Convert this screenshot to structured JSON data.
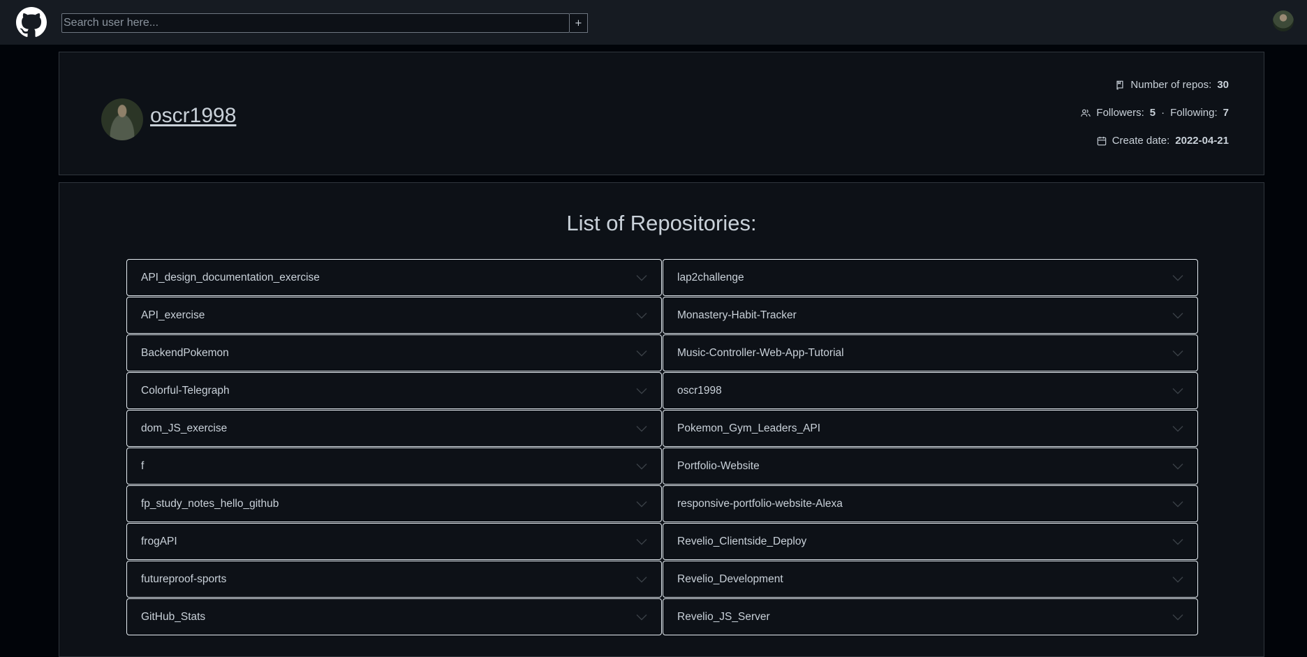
{
  "header": {
    "search_placeholder": "Search user here...",
    "add_label": "+",
    "icons": {
      "logo": "github-logo-icon",
      "avatar": "user-avatar"
    }
  },
  "profile": {
    "username": "oscr1998",
    "repos_label": "Number of repos:",
    "repos_value": "30",
    "followers_label": "Followers:",
    "followers_value": "5",
    "separator": "·",
    "following_label": "Following:",
    "following_value": "7",
    "create_label": "Create date:",
    "create_value": "2022-04-21"
  },
  "repos": {
    "title": "List of Repositories:",
    "left": [
      "API_design_documentation_exercise",
      "API_exercise",
      "BackendPokemon",
      "Colorful-Telegraph",
      "dom_JS_exercise",
      "f",
      "fp_study_notes_hello_github",
      "frogAPI",
      "futureproof-sports",
      "GitHub_Stats"
    ],
    "right": [
      "lap2challenge",
      "Monastery-Habit-Tracker",
      "Music-Controller-Web-App-Tutorial",
      "oscr1998",
      "Pokemon_Gym_Leaders_API",
      "Portfolio-Website",
      "responsive-portfolio-website-Alexa",
      "Revelio_Clientside_Deploy",
      "Revelio_Development",
      "Revelio_JS_Server"
    ]
  },
  "colors": {
    "page_bg": "#010409",
    "topbar_bg": "#161b22",
    "card_bg": "#0d1117",
    "text": "#c9d1d9",
    "item_border": "#e6edf3"
  }
}
